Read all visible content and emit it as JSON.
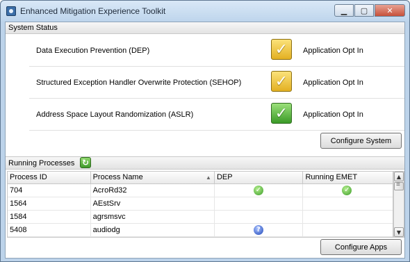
{
  "window": {
    "title": "Enhanced Mitigation Experience Toolkit"
  },
  "system_status": {
    "header": "System Status",
    "items": [
      {
        "label": "Data Execution Prevention (DEP)",
        "state": "Application Opt In",
        "check_icon": "yellow-check-icon",
        "color": "#e3b022"
      },
      {
        "label": "Structured Exception Handler Overwrite Protection (SEHOP)",
        "state": "Application Opt In",
        "check_icon": "yellow-check-icon",
        "color": "#e3b022"
      },
      {
        "label": "Address Space Layout Randomization (ASLR)",
        "state": "Application Opt In",
        "check_icon": "green-check-icon",
        "color": "#3a9a27"
      }
    ],
    "configure_button": "Configure System"
  },
  "running_processes": {
    "header": "Running Processes",
    "refresh_icon": "refresh-icon",
    "columns": [
      "Process ID",
      "Process Name",
      "DEP",
      "Running EMET"
    ],
    "rows": [
      {
        "pid": "704",
        "name": "AcroRd32",
        "dep": "ok",
        "emet": "ok"
      },
      {
        "pid": "1564",
        "name": "AEstSrv",
        "dep": "",
        "emet": ""
      },
      {
        "pid": "1584",
        "name": "agrsmsvc",
        "dep": "",
        "emet": ""
      },
      {
        "pid": "5408",
        "name": "audiodg",
        "dep": "unknown",
        "emet": ""
      }
    ],
    "configure_button": "Configure Apps"
  }
}
